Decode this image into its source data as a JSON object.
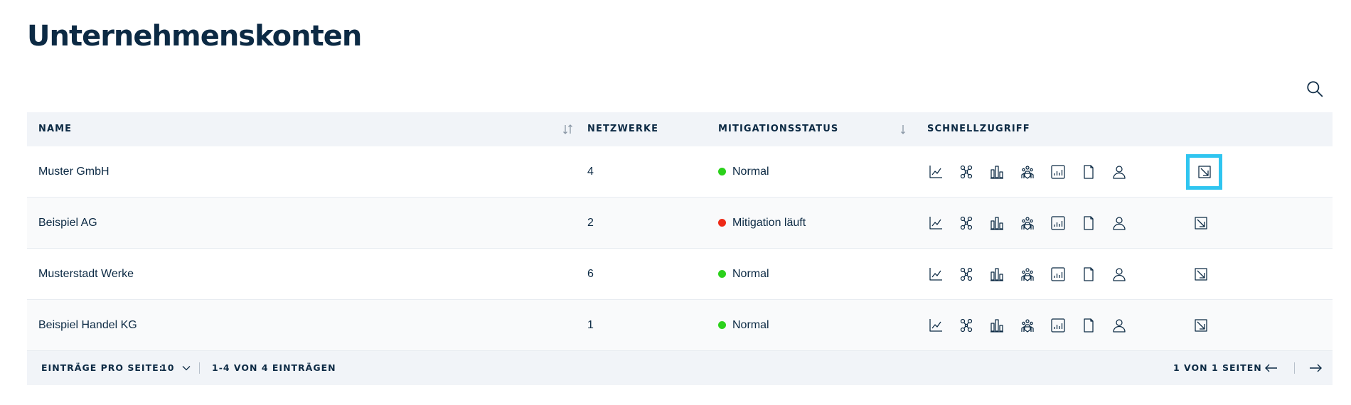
{
  "page": {
    "title": "Unternehmenskonten"
  },
  "search": {
    "icon": "search-icon"
  },
  "table": {
    "headers": {
      "name": "NAME",
      "networks": "NETZWERKE",
      "mitigation": "MITIGATIONSSTATUS",
      "quick": "SCHNELLZUGRIFF"
    },
    "rows": [
      {
        "name": "Muster GmbH",
        "networks": "4",
        "status": "Normal",
        "status_color": "#2bd11b"
      },
      {
        "name": "Beispiel AG",
        "networks": "2",
        "status": "Mitigation läuft",
        "status_color": "#ee2a17"
      },
      {
        "name": "Musterstadt Werke",
        "networks": "6",
        "status": "Normal",
        "status_color": "#2bd11b"
      },
      {
        "name": "Beispiel Handel KG",
        "networks": "1",
        "status": "Normal",
        "status_color": "#2bd11b"
      }
    ],
    "quick_icons": [
      "chart-line-icon",
      "network-icon",
      "bar-chart-icon",
      "shield-crowd-icon",
      "report-icon",
      "document-icon",
      "user-icon"
    ],
    "open_icon": "external-link-icon",
    "active_row": 0
  },
  "footer": {
    "per_page_label": "EINTRÄGE PRO SEITE:",
    "per_page_value": "10",
    "range": "1-4 VON 4 EINTRÄGEN",
    "pages": "1 VON 1 SEITEN"
  },
  "colors": {
    "accent": "#2fc5f0",
    "text": "#0c2a44",
    "header_bg": "#f1f4f8"
  }
}
